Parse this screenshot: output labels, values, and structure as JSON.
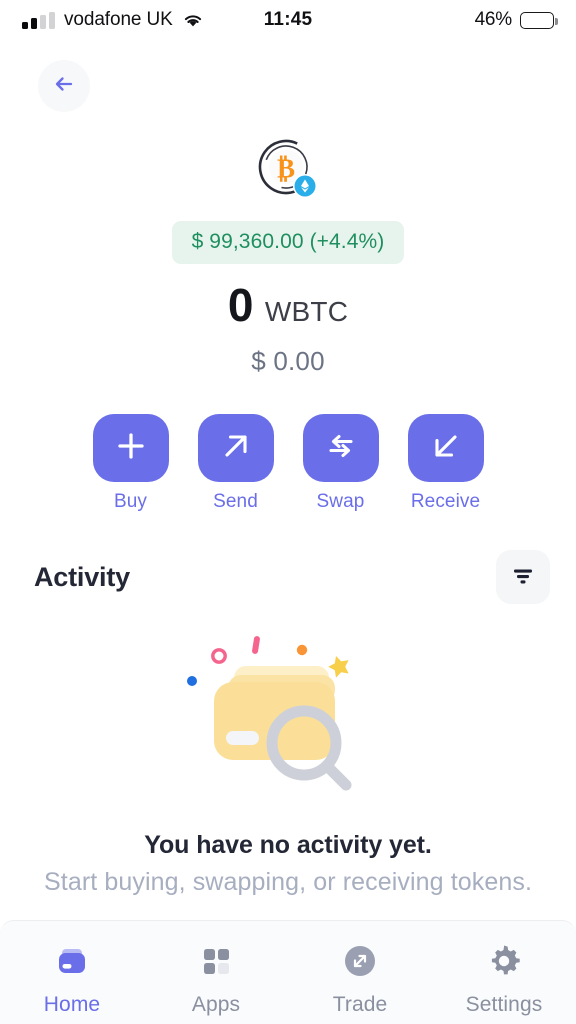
{
  "status_bar": {
    "carrier": "vodafone UK",
    "time": "11:45",
    "battery_percent": "46%",
    "signal_bars_active": 2,
    "signal_bars_total": 4,
    "wifi_icon": "wifi-icon",
    "battery_icon": "battery-icon"
  },
  "header": {
    "back_icon": "arrow-left-icon",
    "token_icon": "wbtc-token-icon",
    "token_chain_badge_icon": "ethereum-badge-icon",
    "price_pill": "$ 99,360.00 (+4.4%)",
    "price_value": "$ 99,360.00",
    "price_change": "(+4.4%)",
    "balance_amount": "0",
    "balance_symbol": "WBTC",
    "balance_fiat": "$ 0.00"
  },
  "actions": [
    {
      "label": "Buy",
      "icon": "plus-icon"
    },
    {
      "label": "Send",
      "icon": "arrow-up-right-icon"
    },
    {
      "label": "Swap",
      "icon": "swap-arrows-icon"
    },
    {
      "label": "Receive",
      "icon": "arrow-down-left-icon"
    }
  ],
  "activity": {
    "title": "Activity",
    "filter_icon": "filter-icon",
    "empty_illustration": "empty-wallet-search-illustration",
    "empty_title": "You have no activity yet.",
    "empty_subtitle": "Start buying, swapping, or receiving tokens."
  },
  "tabbar": [
    {
      "label": "Home",
      "icon": "wallet-icon",
      "active": true
    },
    {
      "label": "Apps",
      "icon": "grid-icon",
      "active": false
    },
    {
      "label": "Trade",
      "icon": "expand-arrows-icon",
      "active": false
    },
    {
      "label": "Settings",
      "icon": "gear-icon",
      "active": false
    }
  ],
  "colors": {
    "accent": "#6a6ee8",
    "positive": "#1f8f5f",
    "positive_bg": "#e7f4ed",
    "text_dark": "#242836",
    "text_muted": "#a7aec0",
    "bitcoin_orange": "#f7931a"
  }
}
